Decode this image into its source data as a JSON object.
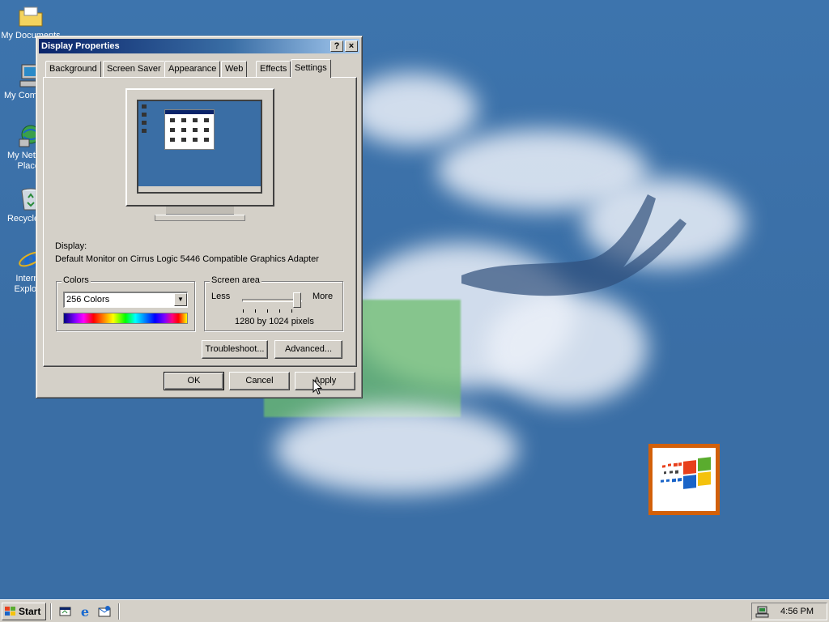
{
  "desktop": {
    "icons": [
      {
        "label": "My Documents",
        "icon": "folder-icon"
      },
      {
        "label": "My Computer",
        "icon": "computer-icon"
      },
      {
        "label": "My Network Places",
        "icon": "network-icon"
      },
      {
        "label": "Recycle Bin",
        "icon": "recycle-bin-icon"
      },
      {
        "label": "Internet Explorer",
        "icon": "ie-icon"
      }
    ]
  },
  "window": {
    "title": "Display Properties",
    "help_label": "?",
    "close_label": "×",
    "tabs": [
      {
        "label": "Background"
      },
      {
        "label": "Screen Saver"
      },
      {
        "label": "Appearance"
      },
      {
        "label": "Web"
      },
      {
        "label": "Effects"
      },
      {
        "label": "Settings"
      }
    ],
    "active_tab": "Settings",
    "display_label": "Display:",
    "display_value": "Default Monitor on Cirrus Logic 5446 Compatible Graphics Adapter",
    "colors": {
      "group_label": "Colors",
      "selected": "256 Colors"
    },
    "screen_area": {
      "group_label": "Screen area",
      "less_label": "Less",
      "more_label": "More",
      "level": 1.0,
      "resolution_text": "1280 by 1024 pixels"
    },
    "buttons": {
      "troubleshoot": "Troubleshoot...",
      "advanced": "Advanced...",
      "ok": "OK",
      "cancel": "Cancel",
      "apply": "Apply"
    }
  },
  "taskbar": {
    "start_label": "Start",
    "quick_launch": [
      "show-desktop-icon",
      "ie-quicklaunch-icon",
      "outlook-express-icon"
    ],
    "clock": "4:56 PM"
  },
  "colors": {
    "desktop_blue": "#3a6ea5",
    "titlebar_start": "#0a246a",
    "titlebar_end": "#a6caf0",
    "face": "#d4d0c8",
    "logo_border": "#d2600a"
  }
}
